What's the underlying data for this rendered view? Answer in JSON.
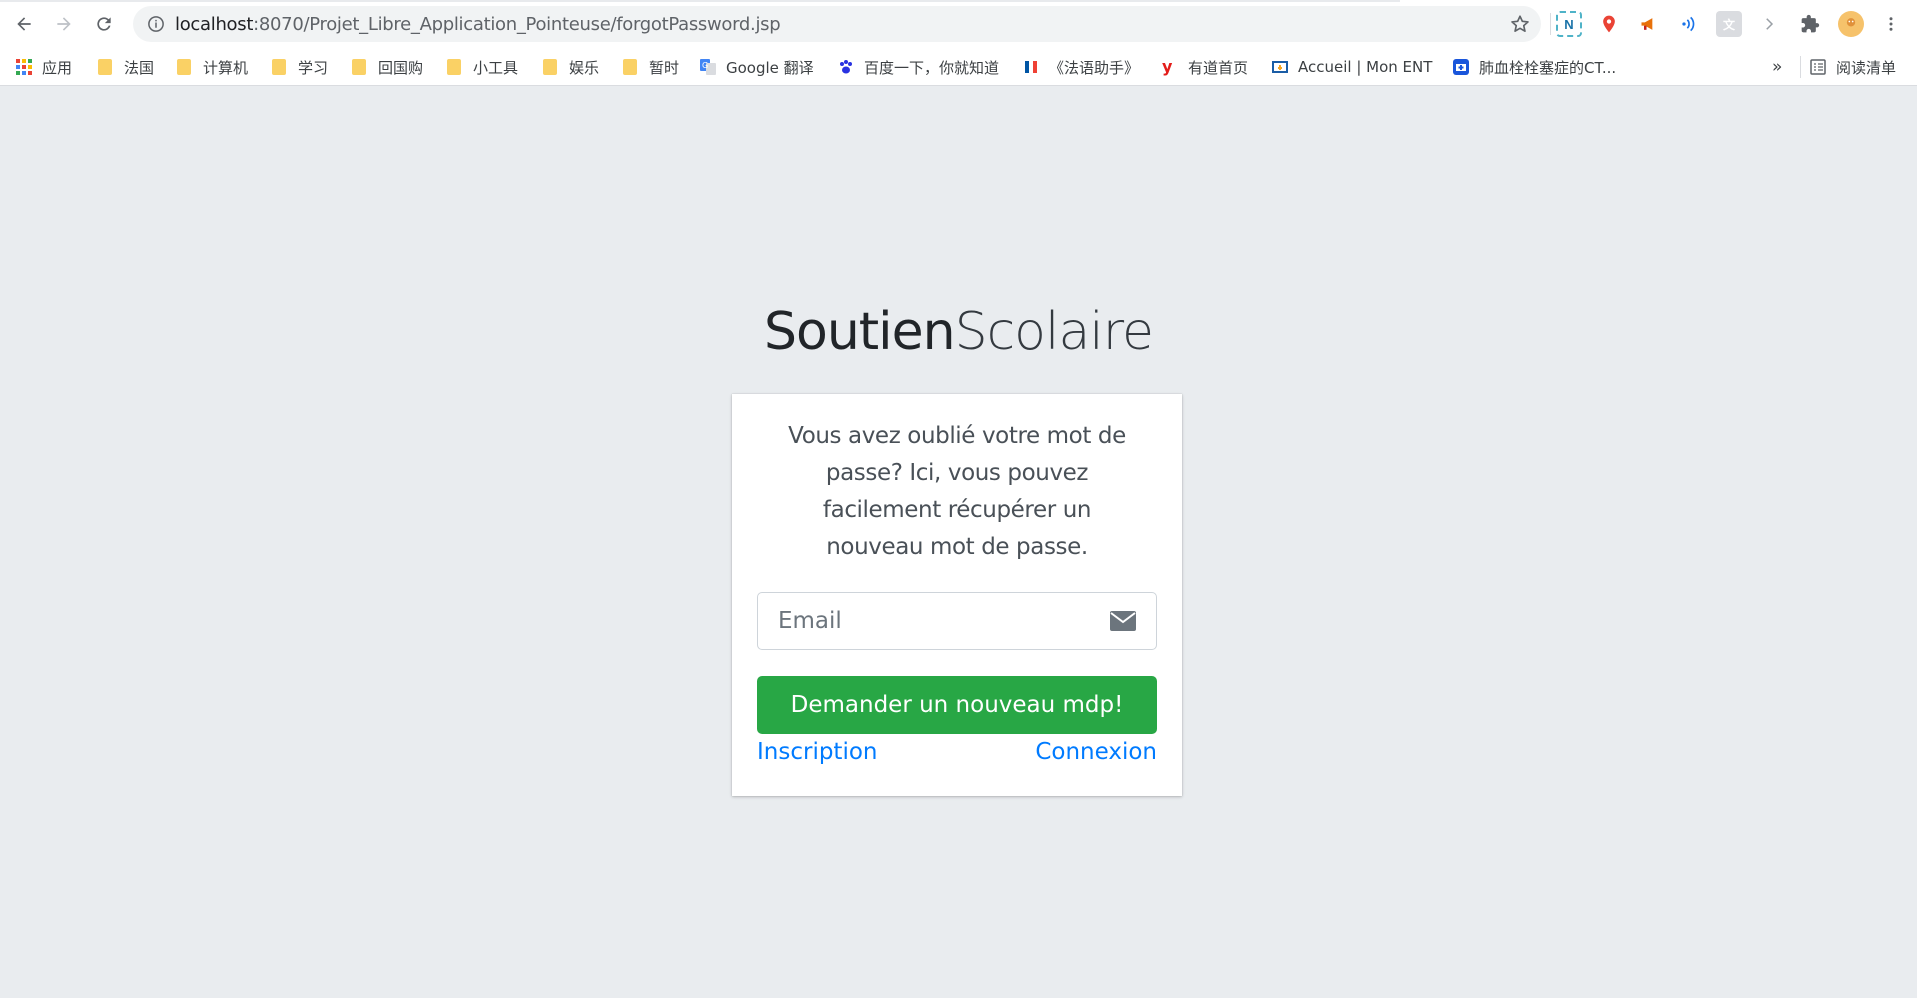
{
  "browser": {
    "url_host": "localhost",
    "url_path": ":8070/Projet_Libre_Application_Pointeuse/forgotPassword.jsp",
    "bookmarks": [
      {
        "label": "应用",
        "icon": "apps-grid-icon"
      },
      {
        "label": "法国",
        "icon": "folder-icon"
      },
      {
        "label": "计算机",
        "icon": "folder-icon"
      },
      {
        "label": "学习",
        "icon": "folder-icon"
      },
      {
        "label": "回国购",
        "icon": "folder-icon"
      },
      {
        "label": "小工具",
        "icon": "folder-icon"
      },
      {
        "label": "娱乐",
        "icon": "folder-icon"
      },
      {
        "label": "暂时",
        "icon": "folder-icon"
      },
      {
        "label": "Google 翻译",
        "icon": "google-translate-icon"
      },
      {
        "label": "百度一下，你就知道",
        "icon": "baidu-paw-icon"
      },
      {
        "label": "《法语助手》",
        "icon": "french-flag-icon"
      },
      {
        "label": "有道首页",
        "icon": "youdao-icon"
      },
      {
        "label": "Accueil | Mon ENT",
        "icon": "ent-icon"
      },
      {
        "label": "肺血栓栓塞症的CT...",
        "icon": "medical-site-icon"
      }
    ],
    "more_bookmarks": "»",
    "reading_list": "阅读清单"
  },
  "page": {
    "brand_bold": "Soutien",
    "brand_light": "Scolaire",
    "message": "Vous avez oublié votre mot de passe? Ici, vous pouvez facilement récupérer un nouveau mot de passe.",
    "email_placeholder": "Email",
    "submit_label": "Demander un nouveau mdp!",
    "signup_link": "Inscription",
    "login_link": "Connexion"
  },
  "colors": {
    "page_bg": "#e9ecef",
    "submit_bg": "#28a745",
    "link": "#007bff"
  }
}
